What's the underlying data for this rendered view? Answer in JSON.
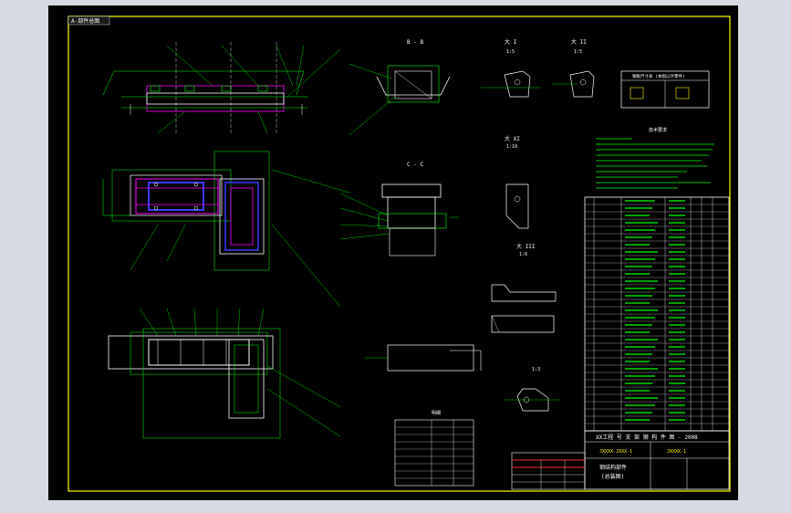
{
  "drawing": {
    "tab_label": "A-部件总图",
    "background": "#000000",
    "colors": {
      "frame": "#ffff00",
      "outline": "#00ff00",
      "steel": "#ffffff",
      "members": "#ff00ff",
      "blue": "#3b3bff",
      "cyan": "#00ffff",
      "red": "#ff3030"
    }
  },
  "views": {
    "section_bb": "B - B",
    "section_cc": "C - C",
    "detail_i": "大 I",
    "detail_ii": "大 II",
    "detail_xi": "大 XI",
    "detail_iii": "大 III",
    "scale_1_5": "1:5",
    "scale_1_10": "1:10",
    "scale_1_6": "1:6",
    "scale_1_3": "1:3"
  },
  "legend_box": {
    "title": "钢板尺寸表 (本图以外零件)"
  },
  "notes": {
    "title": "技术要求"
  },
  "small_table": {
    "title": "明细"
  },
  "title_block": {
    "project": "XX工程 号 支 架 钢 构 件 图 - 2008",
    "drawing_no": "JXXXX-JXXX-1",
    "sheet": "JXXXX-1",
    "name_line1": "钢结构部件",
    "name_line2": "(总装图)"
  }
}
